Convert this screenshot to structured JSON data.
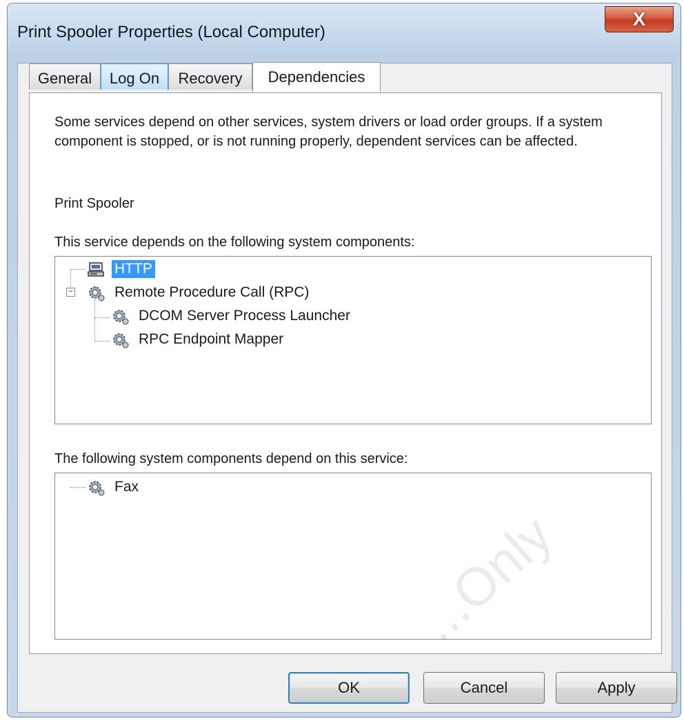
{
  "window": {
    "title": "Print Spooler Properties (Local Computer)",
    "close_label": "X"
  },
  "tabs": [
    {
      "label": "General"
    },
    {
      "label": "Log On"
    },
    {
      "label": "Recovery"
    },
    {
      "label": "Dependencies"
    }
  ],
  "active_tab": "Dependencies",
  "dependencies": {
    "description": "Some services depend on other services, system drivers or load order groups. If a system component is stopped, or is not running properly, dependent services can be affected.",
    "service_name": "Print Spooler",
    "depends_on_label": "This service depends on the following system components:",
    "depends_on_tree": [
      {
        "label": "HTTP",
        "icon": "driver-icon",
        "selected": true
      },
      {
        "label": "Remote Procedure Call (RPC)",
        "icon": "service-gear-icon",
        "expanded": true,
        "children": [
          {
            "label": "DCOM Server Process Launcher",
            "icon": "service-gear-icon"
          },
          {
            "label": "RPC Endpoint Mapper",
            "icon": "service-gear-icon"
          }
        ]
      }
    ],
    "dependents_label": "The following system components depend on this service:",
    "dependents_tree": [
      {
        "label": "Fax",
        "icon": "service-gear-icon"
      }
    ]
  },
  "buttons": {
    "ok": "OK",
    "cancel": "Cancel",
    "apply": "Apply"
  },
  "watermark": "...Only",
  "colors": {
    "selection": "#3399ff",
    "close_button": "#c23b1f",
    "hover_tab": "#bfe0f7"
  }
}
